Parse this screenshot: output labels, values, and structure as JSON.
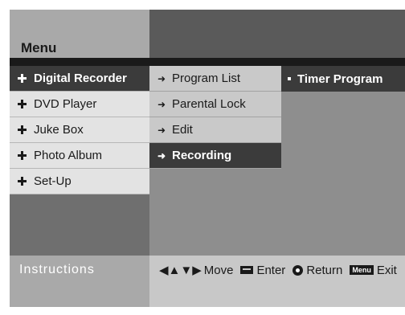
{
  "menu": {
    "title": "Menu"
  },
  "main_menu": [
    {
      "label": "Digital Recorder",
      "active": true
    },
    {
      "label": "DVD Player",
      "active": false
    },
    {
      "label": "Juke Box",
      "active": false
    },
    {
      "label": "Photo Album",
      "active": false
    },
    {
      "label": "Set-Up",
      "active": false
    }
  ],
  "submenu": [
    {
      "label": "Program List",
      "active": false
    },
    {
      "label": "Parental Lock",
      "active": false
    },
    {
      "label": "Edit",
      "active": false
    },
    {
      "label": "Recording",
      "active": true
    }
  ],
  "third_menu": [
    {
      "label": "Timer Program"
    }
  ],
  "instructions": {
    "title": "Instructions",
    "move": "Move",
    "enter": "Enter",
    "return": "Return",
    "menu_key": "Menu",
    "exit": "Exit"
  },
  "icons": {
    "main_item": "plus-icon",
    "sub_item": "arrow-right-icon",
    "third_item": "bullet-icon"
  },
  "colors": {
    "active_bg": "#3b3b3b",
    "main_bg": "#e3e3e3",
    "sub_bg": "#c9c9c9",
    "panel_bg": "#8e8e8e"
  }
}
